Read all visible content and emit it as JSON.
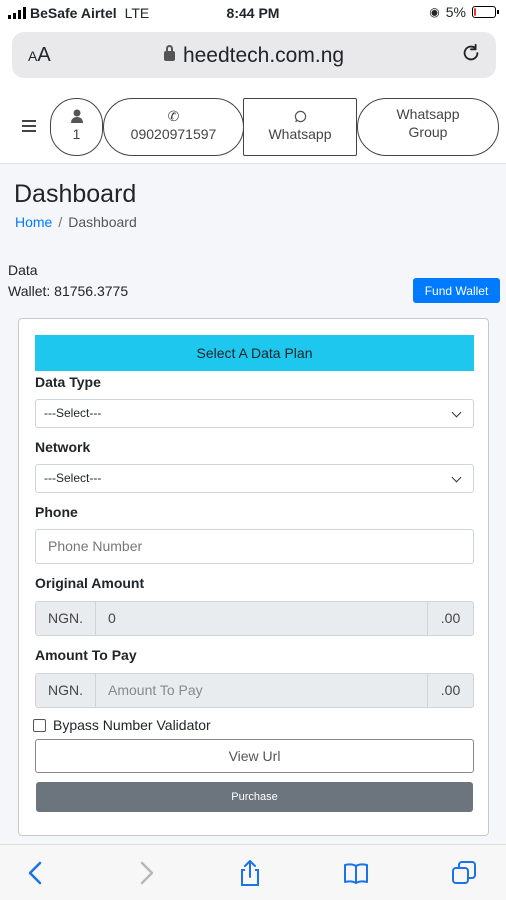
{
  "status_bar": {
    "carrier": "BeSafe Airtel",
    "network": "LTE",
    "time": "8:44 PM",
    "battery": "5%",
    "battery_level": 0.05,
    "battery_color": "#e53935"
  },
  "browser": {
    "text_size_label": "AA",
    "domain": "heedtech.com.ng"
  },
  "topnav": {
    "cart_count": "1",
    "phone": "09020971597",
    "whatsapp": "Whatsapp",
    "group_line1": "Whatsapp",
    "group_line2": "Group"
  },
  "page": {
    "title": "Dashboard",
    "breadcrumb_home": "Home",
    "breadcrumb_sep": "/",
    "breadcrumb_current": "Dashboard"
  },
  "wallet": {
    "line1": "Data",
    "line2": "Wallet: 81756.3775",
    "fund_button": "Fund Wallet"
  },
  "form": {
    "header": "Select A Data Plan",
    "data_type_label": "Data Type",
    "data_type_value": "---Select---",
    "network_label": "Network",
    "network_value": "---Select---",
    "phone_label": "Phone",
    "phone_placeholder": "Phone Number",
    "original_amount_label": "Original Amount",
    "original_prefix": "NGN.",
    "original_value": "0",
    "original_suffix": ".00",
    "amount_to_pay_label": "Amount To Pay",
    "pay_prefix": "NGN.",
    "pay_placeholder": "Amount To Pay",
    "pay_suffix": ".00",
    "bypass_label": "Bypass Number Validator",
    "view_url_button": "View Url",
    "purchase_button": "Purchase"
  },
  "colors": {
    "primary": "#007bff",
    "header_cyan": "#1ec7ee",
    "secondary": "#6c757d",
    "ios_blue": "#1a73e8"
  }
}
